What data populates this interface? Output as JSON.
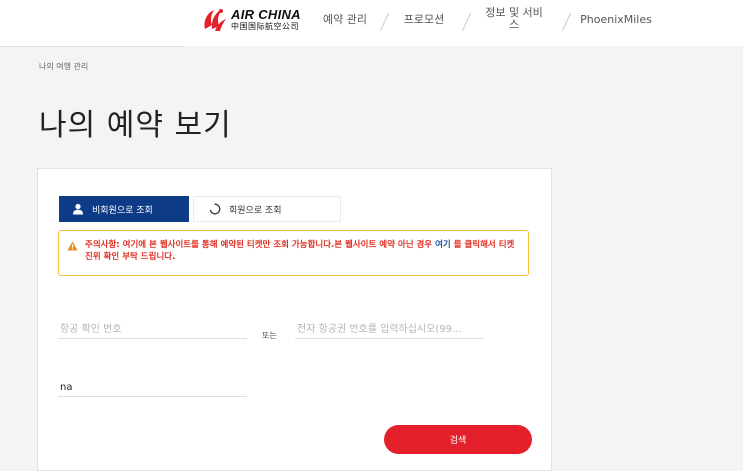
{
  "header": {
    "logo": {
      "name_en": "AIR CHINA",
      "name_cn": "中国国际航空公司",
      "icon": "phoenix-logo-icon",
      "brand_color": "#e4202a"
    },
    "nav": [
      {
        "label": "예약 관리"
      },
      {
        "label": "프로모션"
      },
      {
        "label": "정보 및 서비스"
      },
      {
        "label": "PhoenixMiles"
      }
    ]
  },
  "breadcrumb": "나의 여행 관리",
  "page_title": "나의 예약 보기",
  "tabs": {
    "guest": {
      "label": "비회원으로 조회",
      "icon": "user-icon",
      "active": true,
      "color": "#0e3b86"
    },
    "member": {
      "label": "회원으로 조회",
      "icon": "loading-spinner-icon",
      "active": false
    }
  },
  "notice": {
    "icon": "warning-icon",
    "text_before": "주의사항: 여기에 본 웹사이트를 통해 예약된 티켓만 조회 가능합니다.본 웹사이트 예약 아닌 경우 ",
    "link": "여기",
    "text_after": " 를 클릭해서 티켓 진위 확인 부탁 드립니다.",
    "border_color": "#f2bf3b",
    "text_color": "#e03024"
  },
  "form": {
    "confirmation_placeholder": "항공 확인 번호",
    "or_label": "또는",
    "eticket_placeholder": "전자 항공권 번호를 입력하십시오(99...",
    "name_value": "na",
    "search_label": "검색"
  }
}
